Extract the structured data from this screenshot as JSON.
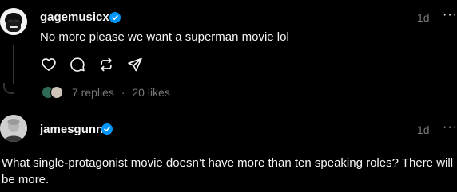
{
  "post1": {
    "username": "gagemusicx",
    "time": "1d",
    "more_label": "···",
    "text": "No more please we want a superman movie lol",
    "replies_label": "7 replies",
    "separator": "·",
    "likes_label": "20 likes",
    "icons": [
      "heart-icon",
      "comment-icon",
      "repost-icon",
      "share-icon"
    ]
  },
  "post2": {
    "username": "jamesgunn",
    "time": "1d",
    "more_label": "···",
    "text": "What single-protagonist movie doesn’t have more than ten speaking roles? There will be more."
  },
  "colors": {
    "background": "#000000",
    "text": "#f3f5f7",
    "muted": "#777777",
    "verified": "#0095f6"
  }
}
